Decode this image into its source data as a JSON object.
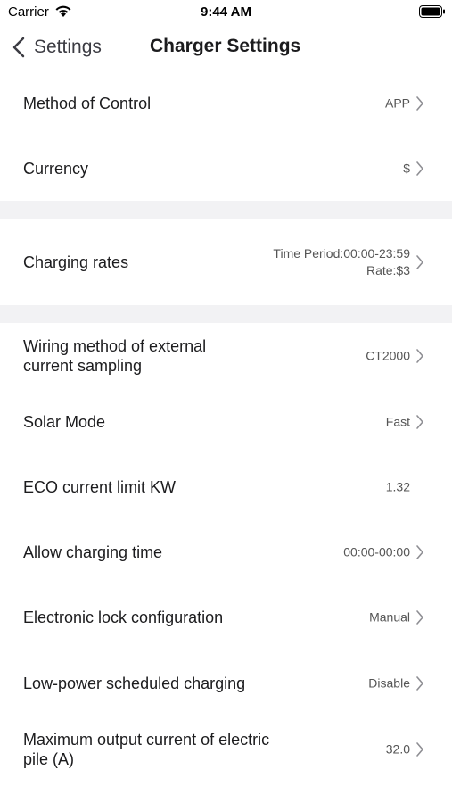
{
  "status_bar": {
    "carrier": "Carrier",
    "time": "9:44 AM",
    "icons": [
      "wifi-icon",
      "battery-icon"
    ]
  },
  "nav": {
    "back_label": "Settings",
    "title": "Charger Settings",
    "back_icon": "chevron-left-icon"
  },
  "rows": {
    "method_of_control": {
      "label": "Method of Control",
      "value": "APP"
    },
    "currency": {
      "label": "Currency",
      "value": "$"
    },
    "charging_rates": {
      "label": "Charging rates",
      "value_line1": "Time Period:00:00-23:59",
      "value_line2": "Rate:$3"
    },
    "wiring_method": {
      "label_line1": "Wiring method of external",
      "label_line2": "current sampling",
      "value": "CT2000"
    },
    "solar_mode": {
      "label": "Solar Mode",
      "value": "Fast"
    },
    "eco_limit": {
      "label": "ECO current limit KW",
      "value": "1.32"
    },
    "allow_time": {
      "label": "Allow charging time",
      "value": "00:00-00:00"
    },
    "lock_config": {
      "label": "Electronic lock configuration",
      "value": "Manual"
    },
    "low_power": {
      "label": "Low-power scheduled charging",
      "value": "Disable"
    },
    "max_current": {
      "label_line1": "Maximum output current of electric",
      "label_line2": "pile (A)",
      "value": "32.0"
    }
  },
  "colors": {
    "section_gap": "#f2f2f4",
    "text_primary": "#1c1c1e",
    "text_secondary": "#555555",
    "chevron": "#8e8e93"
  }
}
